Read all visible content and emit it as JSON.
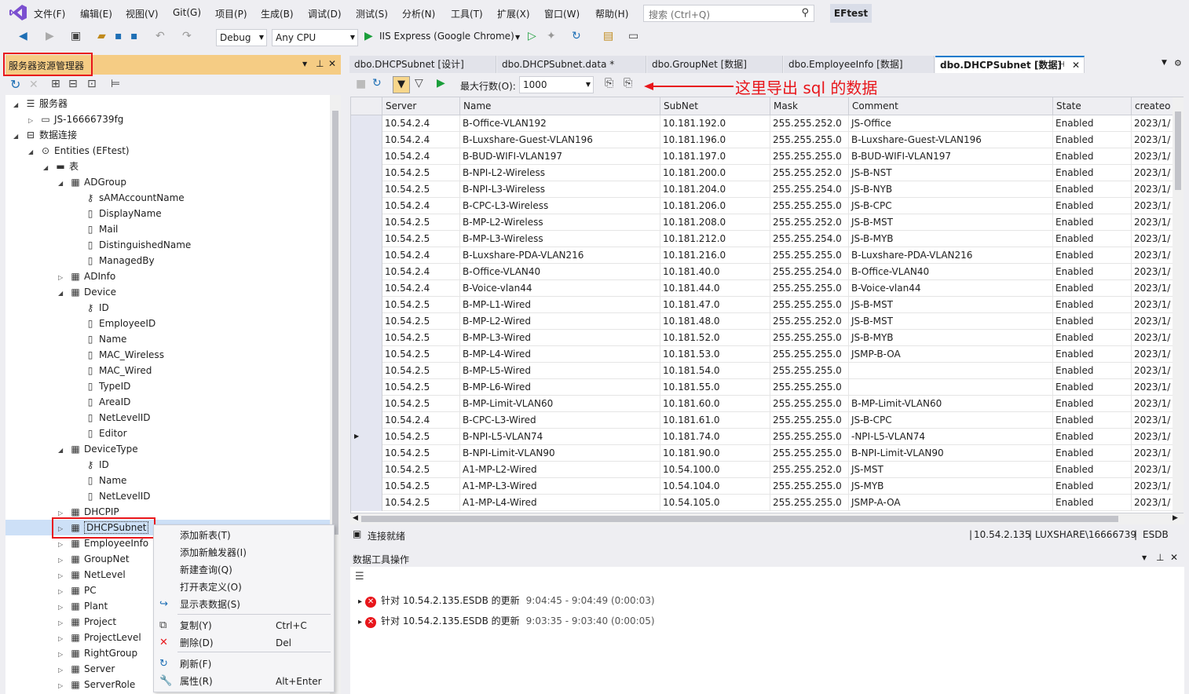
{
  "menu": [
    "文件(F)",
    "编辑(E)",
    "视图(V)",
    "Git(G)",
    "项目(P)",
    "生成(B)",
    "调试(D)",
    "测试(S)",
    "分析(N)",
    "工具(T)",
    "扩展(X)",
    "窗口(W)",
    "帮助(H)"
  ],
  "search": {
    "placeholder": "搜索 (Ctrl+Q)",
    "icon": "search-icon"
  },
  "project_name": "EFtest",
  "toolbar": {
    "config": "Debug",
    "platform": "Any CPU",
    "run_label": "IIS Express (Google Chrome)"
  },
  "server_explorer": {
    "title": "服务器资源管理器"
  },
  "tree": [
    {
      "label": "服务器",
      "indent": 0,
      "exp": "◢",
      "icon": "server-icon"
    },
    {
      "label": "JS-16666739fg",
      "indent": 1,
      "exp": "▷",
      "icon": "computer-icon"
    },
    {
      "label": "数据连接",
      "indent": 0,
      "exp": "◢",
      "icon": "data-connection-icon"
    },
    {
      "label": "Entities (EFtest)",
      "indent": 1,
      "exp": "◢",
      "icon": "database-icon"
    },
    {
      "label": "表",
      "indent": 2,
      "exp": "◢",
      "icon": "folder-icon"
    },
    {
      "label": "ADGroup",
      "indent": 3,
      "exp": "◢",
      "icon": "table-icon"
    },
    {
      "label": "sAMAccountName",
      "indent": 4,
      "exp": "",
      "icon": "key-icon"
    },
    {
      "label": "DisplayName",
      "indent": 4,
      "exp": "",
      "icon": "column-icon"
    },
    {
      "label": "Mail",
      "indent": 4,
      "exp": "",
      "icon": "column-icon"
    },
    {
      "label": "DistinguishedName",
      "indent": 4,
      "exp": "",
      "icon": "column-icon"
    },
    {
      "label": "ManagedBy",
      "indent": 4,
      "exp": "",
      "icon": "column-icon"
    },
    {
      "label": "ADInfo",
      "indent": 3,
      "exp": "▷",
      "icon": "table-icon"
    },
    {
      "label": "Device",
      "indent": 3,
      "exp": "◢",
      "icon": "table-icon"
    },
    {
      "label": "ID",
      "indent": 4,
      "exp": "",
      "icon": "key-icon"
    },
    {
      "label": "EmployeeID",
      "indent": 4,
      "exp": "",
      "icon": "column-icon"
    },
    {
      "label": "Name",
      "indent": 4,
      "exp": "",
      "icon": "column-icon"
    },
    {
      "label": "MAC_Wireless",
      "indent": 4,
      "exp": "",
      "icon": "column-icon"
    },
    {
      "label": "MAC_Wired",
      "indent": 4,
      "exp": "",
      "icon": "column-icon"
    },
    {
      "label": "TypeID",
      "indent": 4,
      "exp": "",
      "icon": "column-icon"
    },
    {
      "label": "AreaID",
      "indent": 4,
      "exp": "",
      "icon": "column-icon"
    },
    {
      "label": "NetLevelID",
      "indent": 4,
      "exp": "",
      "icon": "column-icon"
    },
    {
      "label": "Editor",
      "indent": 4,
      "exp": "",
      "icon": "column-icon"
    },
    {
      "label": "DeviceType",
      "indent": 3,
      "exp": "◢",
      "icon": "table-icon"
    },
    {
      "label": "ID",
      "indent": 4,
      "exp": "",
      "icon": "key-icon"
    },
    {
      "label": "Name",
      "indent": 4,
      "exp": "",
      "icon": "column-icon"
    },
    {
      "label": "NetLevelID",
      "indent": 4,
      "exp": "",
      "icon": "column-icon"
    },
    {
      "label": "DHCPIP",
      "indent": 3,
      "exp": "▷",
      "icon": "table-icon"
    },
    {
      "label": "DHCPSubnet",
      "indent": 3,
      "exp": "▷",
      "icon": "table-icon",
      "selected": true
    },
    {
      "label": "EmployeeInfo",
      "indent": 3,
      "exp": "▷",
      "icon": "table-icon"
    },
    {
      "label": "GroupNet",
      "indent": 3,
      "exp": "▷",
      "icon": "table-icon"
    },
    {
      "label": "NetLevel",
      "indent": 3,
      "exp": "▷",
      "icon": "table-icon"
    },
    {
      "label": "PC",
      "indent": 3,
      "exp": "▷",
      "icon": "table-icon"
    },
    {
      "label": "Plant",
      "indent": 3,
      "exp": "▷",
      "icon": "table-icon"
    },
    {
      "label": "Project",
      "indent": 3,
      "exp": "▷",
      "icon": "table-icon"
    },
    {
      "label": "ProjectLevel",
      "indent": 3,
      "exp": "▷",
      "icon": "table-icon"
    },
    {
      "label": "RightGroup",
      "indent": 3,
      "exp": "▷",
      "icon": "table-icon"
    },
    {
      "label": "Server",
      "indent": 3,
      "exp": "▷",
      "icon": "table-icon"
    },
    {
      "label": "ServerRole",
      "indent": 3,
      "exp": "▷",
      "icon": "table-icon"
    }
  ],
  "context_menu": [
    {
      "label": "添加新表(T)",
      "shortcut": "",
      "icon": ""
    },
    {
      "label": "添加新触发器(I)",
      "shortcut": "",
      "icon": ""
    },
    {
      "label": "新建查询(Q)",
      "shortcut": "",
      "icon": ""
    },
    {
      "label": "打开表定义(O)",
      "shortcut": "",
      "icon": ""
    },
    {
      "label": "显示表数据(S)",
      "shortcut": "",
      "icon": "show-data-icon"
    },
    {
      "label": "复制(Y)",
      "shortcut": "Ctrl+C",
      "icon": "copy-icon"
    },
    {
      "label": "删除(D)",
      "shortcut": "Del",
      "icon": "delete-icon"
    },
    {
      "label": "刷新(F)",
      "shortcut": "",
      "icon": "refresh-icon"
    },
    {
      "label": "属性(R)",
      "shortcut": "Alt+Enter",
      "icon": "properties-icon"
    }
  ],
  "tabs": [
    "dbo.DHCPSubnet [设计]",
    "dbo.DHCPSubnet.data *",
    "dbo.GroupNet [数据]",
    "dbo.EmployeeInfo [数据]",
    "dbo.DHCPSubnet [数据]"
  ],
  "grid_toolbar": {
    "max_rows_label": "最大行数(O):",
    "max_rows_value": "1000"
  },
  "annotation": "这里导出 sql 的数据",
  "columns": [
    "Server",
    "Name",
    "SubNet",
    "Mask",
    "Comment",
    "State",
    "createo"
  ],
  "rows": [
    [
      "10.54.2.4",
      "B-Office-VLAN192",
      "10.181.192.0",
      "255.255.252.0",
      "JS-Office",
      "Enabled",
      "2023/1/"
    ],
    [
      "10.54.2.4",
      "B-Luxshare-Guest-VLAN196",
      "10.181.196.0",
      "255.255.255.0",
      "B-Luxshare-Guest-VLAN196",
      "Enabled",
      "2023/1/"
    ],
    [
      "10.54.2.4",
      "B-BUD-WIFI-VLAN197",
      "10.181.197.0",
      "255.255.255.0",
      "B-BUD-WIFI-VLAN197",
      "Enabled",
      "2023/1/"
    ],
    [
      "10.54.2.5",
      "B-NPI-L2-Wireless",
      "10.181.200.0",
      "255.255.252.0",
      "JS-B-NST",
      "Enabled",
      "2023/1/"
    ],
    [
      "10.54.2.5",
      "B-NPI-L3-Wireless",
      "10.181.204.0",
      "255.255.254.0",
      "JS-B-NYB",
      "Enabled",
      "2023/1/"
    ],
    [
      "10.54.2.4",
      "B-CPC-L3-Wireless",
      "10.181.206.0",
      "255.255.255.0",
      "JS-B-CPC",
      "Enabled",
      "2023/1/"
    ],
    [
      "10.54.2.5",
      "B-MP-L2-Wireless",
      "10.181.208.0",
      "255.255.252.0",
      "JS-B-MST",
      "Enabled",
      "2023/1/"
    ],
    [
      "10.54.2.5",
      "B-MP-L3-Wireless",
      "10.181.212.0",
      "255.255.254.0",
      "JS-B-MYB",
      "Enabled",
      "2023/1/"
    ],
    [
      "10.54.2.4",
      "B-Luxshare-PDA-VLAN216",
      "10.181.216.0",
      "255.255.255.0",
      "B-Luxshare-PDA-VLAN216",
      "Enabled",
      "2023/1/"
    ],
    [
      "10.54.2.4",
      "B-Office-VLAN40",
      "10.181.40.0",
      "255.255.254.0",
      "B-Office-VLAN40",
      "Enabled",
      "2023/1/"
    ],
    [
      "10.54.2.4",
      "B-Voice-vlan44",
      "10.181.44.0",
      "255.255.255.0",
      "B-Voice-vlan44",
      "Enabled",
      "2023/1/"
    ],
    [
      "10.54.2.5",
      "B-MP-L1-Wired",
      "10.181.47.0",
      "255.255.255.0",
      "JS-B-MST",
      "Enabled",
      "2023/1/"
    ],
    [
      "10.54.2.5",
      "B-MP-L2-Wired",
      "10.181.48.0",
      "255.255.252.0",
      "JS-B-MST",
      "Enabled",
      "2023/1/"
    ],
    [
      "10.54.2.5",
      "B-MP-L3-Wired",
      "10.181.52.0",
      "255.255.255.0",
      "JS-B-MYB",
      "Enabled",
      "2023/1/"
    ],
    [
      "10.54.2.5",
      "B-MP-L4-Wired",
      "10.181.53.0",
      "255.255.255.0",
      "JSMP-B-OA",
      "Enabled",
      "2023/1/"
    ],
    [
      "10.54.2.5",
      "B-MP-L5-Wired",
      "10.181.54.0",
      "255.255.255.0",
      "",
      "Enabled",
      "2023/1/"
    ],
    [
      "10.54.2.5",
      "B-MP-L6-Wired",
      "10.181.55.0",
      "255.255.255.0",
      "",
      "Enabled",
      "2023/1/"
    ],
    [
      "10.54.2.5",
      "B-MP-Limit-VLAN60",
      "10.181.60.0",
      "255.255.255.0",
      "B-MP-Limit-VLAN60",
      "Enabled",
      "2023/1/"
    ],
    [
      "10.54.2.4",
      "B-CPC-L3-Wired",
      "10.181.61.0",
      "255.255.255.0",
      "JS-B-CPC",
      "Enabled",
      "2023/1/"
    ],
    [
      "10.54.2.5",
      "B-NPI-L5-VLAN74",
      "10.181.74.0",
      "255.255.255.0",
      "-NPI-L5-VLAN74",
      "Enabled",
      "2023/1/"
    ],
    [
      "10.54.2.5",
      "B-NPI-Limit-VLAN90",
      "10.181.90.0",
      "255.255.255.0",
      "B-NPI-Limit-VLAN90",
      "Enabled",
      "2023/1/"
    ],
    [
      "10.54.2.5",
      "A1-MP-L2-Wired",
      "10.54.100.0",
      "255.255.252.0",
      "JS-MST",
      "Enabled",
      "2023/1/"
    ],
    [
      "10.54.2.5",
      "A1-MP-L3-Wired",
      "10.54.104.0",
      "255.255.255.0",
      "JS-MYB",
      "Enabled",
      "2023/1/"
    ],
    [
      "10.54.2.5",
      "A1-MP-L4-Wired",
      "10.54.105.0",
      "255.255.255.0",
      "JSMP-A-OA",
      "Enabled",
      "2023/1/"
    ]
  ],
  "current_row_index": 19,
  "status": {
    "left": "连接就绪",
    "server": "10.54.2.135",
    "user": "LUXSHARE\\16666739",
    "db": "ESDB"
  },
  "output": {
    "title": "数据工具操作",
    "items": [
      {
        "text": "针对 10.54.2.135.ESDB 的更新",
        "time": "9:04:45 - 9:04:49 (0:00:03)"
      },
      {
        "text": "针对 10.54.2.135.ESDB 的更新",
        "time": "9:03:35 - 9:03:40 (0:00:05)"
      }
    ]
  },
  "colors": {
    "accent": "#007acc",
    "highlight": "#e8161b",
    "panel_header": "#f5cc84"
  }
}
